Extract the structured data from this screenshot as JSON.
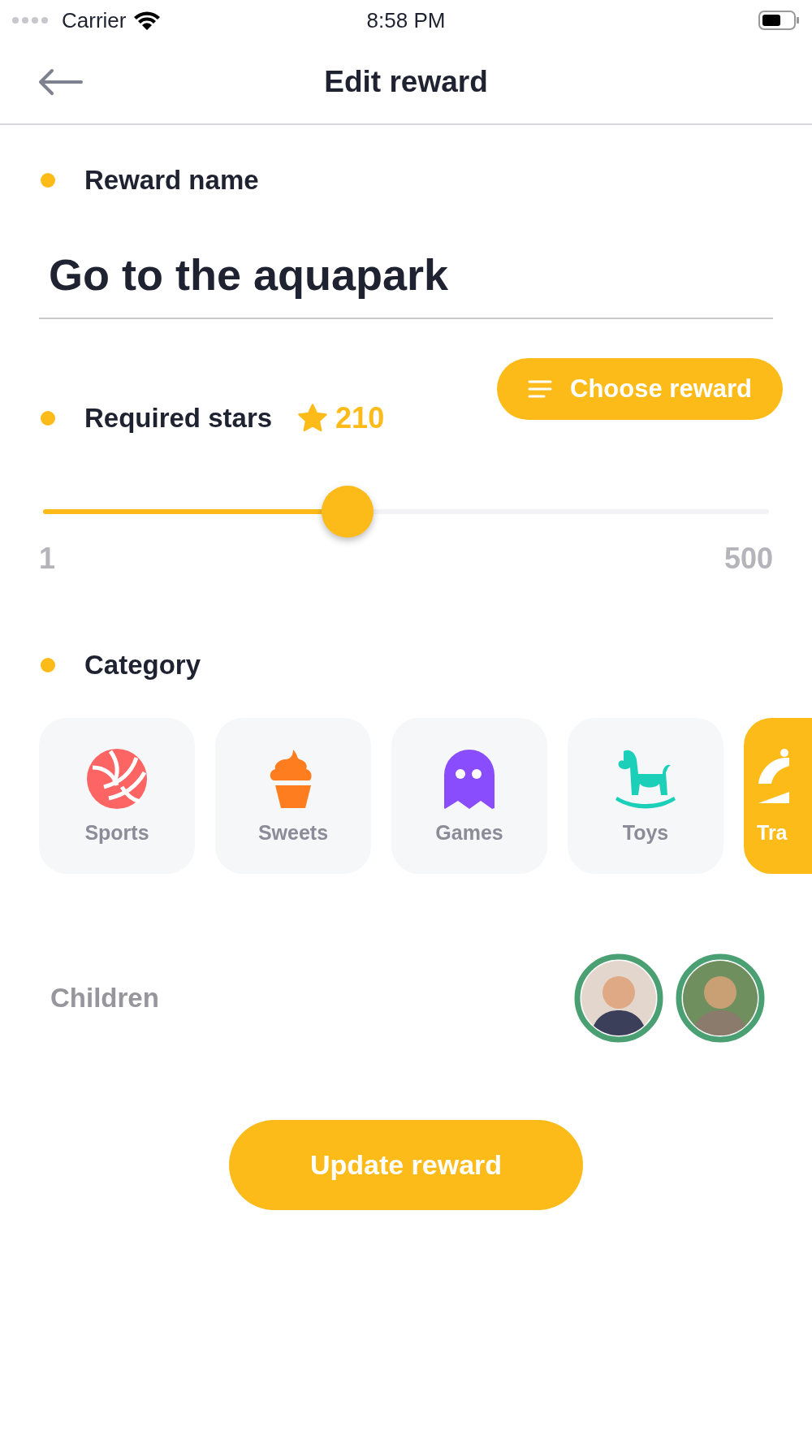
{
  "status_bar": {
    "carrier": "Carrier",
    "time": "8:58 PM"
  },
  "header": {
    "title": "Edit reward"
  },
  "reward_name": {
    "label": "Reward name",
    "value": "Go to the aquapark"
  },
  "choose_button": {
    "label": "Choose reward"
  },
  "required_stars": {
    "label": "Required stars",
    "value": "210",
    "slider": {
      "level": 0.42,
      "min_label": "1",
      "max_label": "500"
    }
  },
  "category": {
    "label": "Category",
    "items": [
      {
        "label": "Sports",
        "kind": "ball",
        "selected": false
      },
      {
        "label": "Sweets",
        "kind": "cupcake",
        "selected": false
      },
      {
        "label": "Games",
        "kind": "ghost",
        "selected": false
      },
      {
        "label": "Toys",
        "kind": "horse",
        "selected": false
      },
      {
        "label": "Tra",
        "kind": "cloche",
        "selected": true
      }
    ]
  },
  "children": {
    "label": "Children",
    "avatars": [
      {
        "selected": true
      },
      {
        "selected": true
      }
    ]
  },
  "submit_button": {
    "label": "Update reward"
  }
}
